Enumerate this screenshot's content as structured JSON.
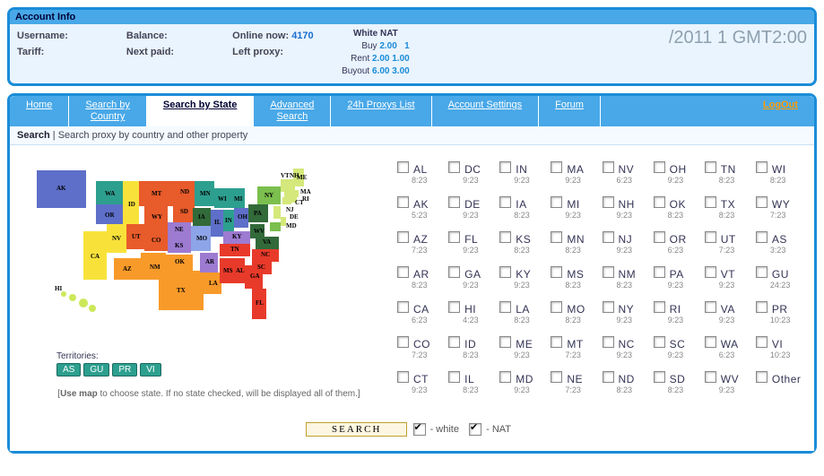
{
  "account": {
    "panel_title": "Account Info",
    "labels": {
      "username": "Username:",
      "balance": "Balance:",
      "online": "Online now:",
      "tariff": "Tariff:",
      "next_paid": "Next paid:",
      "left_proxy": "Left proxy:"
    },
    "online_now": "4170",
    "nat": {
      "title": "White NAT",
      "buy_lbl": "Buy",
      "buy_a": "2.00",
      "buy_b": "1",
      "rent_lbl": "Rent",
      "rent_a": "2.00",
      "rent_b": "1.00",
      "buyout_lbl": "Buyout",
      "buyout_a": "6.00",
      "buyout_b": "3.00"
    },
    "datetime": "   /2011 1        GMT2:00"
  },
  "nav": {
    "home": "Home",
    "by_country": "Search by\nCountry",
    "by_state": "Search by State",
    "advanced": "Advanced\nSearch",
    "proxys24": "24h Proxys List",
    "settings": "Account Settings",
    "forum": "Forum",
    "logout": "LogOut"
  },
  "search_bar": {
    "label": "Search",
    "desc": "Search proxy by country and other property"
  },
  "territories": {
    "label": "Territories:",
    "items": [
      "AS",
      "GU",
      "PR",
      "VI"
    ]
  },
  "map_hint_bold": "Use map",
  "map_hint_rest": " to choose state. If no state checked, will be displayed all of them.]",
  "map_states_overlay": [
    "AK",
    "WA",
    "OR",
    "ID",
    "MT",
    "ND",
    "SD",
    "MN",
    "WI",
    "NV",
    "UT",
    "WY",
    "CO",
    "NE",
    "KS",
    "MO",
    "IA",
    "IL",
    "IN",
    "OH",
    "MI",
    "PA",
    "NY",
    "VT",
    "NH",
    "ME",
    "CA",
    "AZ",
    "NM",
    "OK",
    "TX",
    "LA",
    "AR",
    "MS",
    "AL",
    "TN",
    "KY",
    "WV",
    "VA",
    "NC",
    "SC",
    "GA",
    "FL",
    "MD",
    "DE",
    "NJ",
    "CT",
    "RI",
    "MA",
    "HI"
  ],
  "state_columns": [
    [
      {
        "c": "AL",
        "t": "8:23"
      },
      {
        "c": "AK",
        "t": "5:23"
      },
      {
        "c": "AZ",
        "t": "7:23"
      },
      {
        "c": "AR",
        "t": "8:23"
      },
      {
        "c": "CA",
        "t": "6:23"
      },
      {
        "c": "CO",
        "t": "7:23"
      },
      {
        "c": "CT",
        "t": "9:23"
      }
    ],
    [
      {
        "c": "DC",
        "t": "9:23"
      },
      {
        "c": "DE",
        "t": "9:23"
      },
      {
        "c": "FL",
        "t": "9:23"
      },
      {
        "c": "GA",
        "t": "9:23"
      },
      {
        "c": "HI",
        "t": "4:23"
      },
      {
        "c": "ID",
        "t": "8:23"
      },
      {
        "c": "IL",
        "t": "8:23"
      }
    ],
    [
      {
        "c": "IN",
        "t": "9:23"
      },
      {
        "c": "IA",
        "t": "8:23"
      },
      {
        "c": "KS",
        "t": "8:23"
      },
      {
        "c": "KY",
        "t": "9:23"
      },
      {
        "c": "LA",
        "t": "8:23"
      },
      {
        "c": "ME",
        "t": "9:23"
      },
      {
        "c": "MD",
        "t": "9:23"
      }
    ],
    [
      {
        "c": "MA",
        "t": "9:23"
      },
      {
        "c": "MI",
        "t": "9:23"
      },
      {
        "c": "MN",
        "t": "8:23"
      },
      {
        "c": "MS",
        "t": "8:23"
      },
      {
        "c": "MO",
        "t": "8:23"
      },
      {
        "c": "MT",
        "t": "7:23"
      },
      {
        "c": "NE",
        "t": "7:23"
      }
    ],
    [
      {
        "c": "NV",
        "t": "6:23"
      },
      {
        "c": "NH",
        "t": "9:23"
      },
      {
        "c": "NJ",
        "t": "9:23"
      },
      {
        "c": "NM",
        "t": "8:23"
      },
      {
        "c": "NY",
        "t": "9:23"
      },
      {
        "c": "NC",
        "t": "9:23"
      },
      {
        "c": "ND",
        "t": "8:23"
      }
    ],
    [
      {
        "c": "OH",
        "t": "9:23"
      },
      {
        "c": "OK",
        "t": "8:23"
      },
      {
        "c": "OR",
        "t": "6:23"
      },
      {
        "c": "PA",
        "t": "9:23"
      },
      {
        "c": "RI",
        "t": "9:23"
      },
      {
        "c": "SC",
        "t": "9:23"
      },
      {
        "c": "SD",
        "t": "8:23"
      }
    ],
    [
      {
        "c": "TN",
        "t": "8:23"
      },
      {
        "c": "TX",
        "t": "8:23"
      },
      {
        "c": "UT",
        "t": "7:23"
      },
      {
        "c": "VT",
        "t": "9:23"
      },
      {
        "c": "VA",
        "t": "9:23"
      },
      {
        "c": "WA",
        "t": "6:23"
      },
      {
        "c": "WV",
        "t": "9:23"
      }
    ],
    [
      {
        "c": "WI",
        "t": "8:23"
      },
      {
        "c": "WY",
        "t": "7:23"
      },
      {
        "c": "AS",
        "t": "3:23"
      },
      {
        "c": "GU",
        "t": "24:23"
      },
      {
        "c": "PR",
        "t": "10:23"
      },
      {
        "c": "VI",
        "t": "10:23"
      },
      {
        "c": "Other",
        "t": ""
      }
    ]
  ],
  "search_button": "SEARCH",
  "filter_white": "- white",
  "filter_nat": "- NAT"
}
